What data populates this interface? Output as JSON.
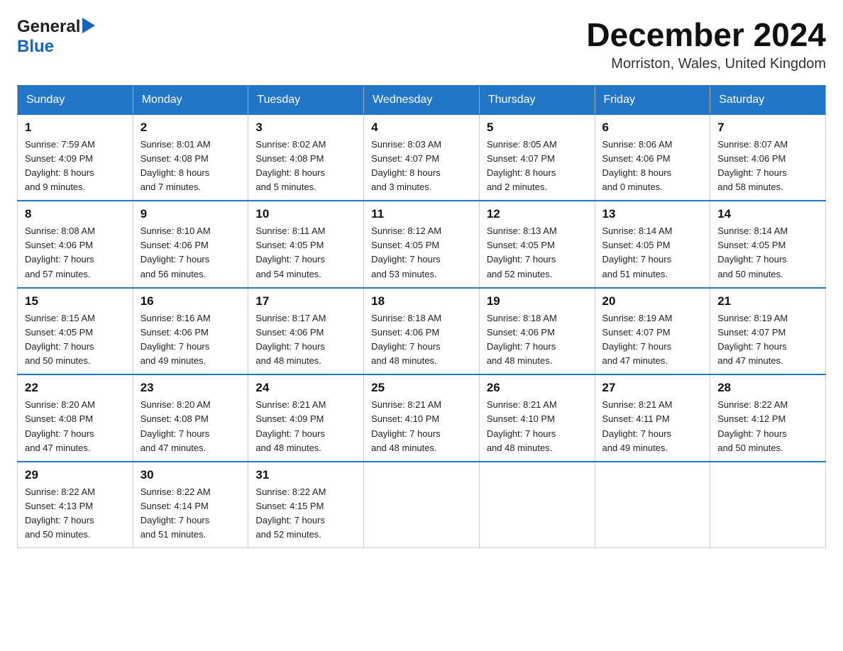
{
  "header": {
    "logo_general": "General",
    "logo_blue": "Blue",
    "month_title": "December 2024",
    "location": "Morriston, Wales, United Kingdom"
  },
  "calendar": {
    "days_of_week": [
      "Sunday",
      "Monday",
      "Tuesday",
      "Wednesday",
      "Thursday",
      "Friday",
      "Saturday"
    ],
    "weeks": [
      [
        {
          "day": "1",
          "info": "Sunrise: 7:59 AM\nSunset: 4:09 PM\nDaylight: 8 hours\nand 9 minutes."
        },
        {
          "day": "2",
          "info": "Sunrise: 8:01 AM\nSunset: 4:08 PM\nDaylight: 8 hours\nand 7 minutes."
        },
        {
          "day": "3",
          "info": "Sunrise: 8:02 AM\nSunset: 4:08 PM\nDaylight: 8 hours\nand 5 minutes."
        },
        {
          "day": "4",
          "info": "Sunrise: 8:03 AM\nSunset: 4:07 PM\nDaylight: 8 hours\nand 3 minutes."
        },
        {
          "day": "5",
          "info": "Sunrise: 8:05 AM\nSunset: 4:07 PM\nDaylight: 8 hours\nand 2 minutes."
        },
        {
          "day": "6",
          "info": "Sunrise: 8:06 AM\nSunset: 4:06 PM\nDaylight: 8 hours\nand 0 minutes."
        },
        {
          "day": "7",
          "info": "Sunrise: 8:07 AM\nSunset: 4:06 PM\nDaylight: 7 hours\nand 58 minutes."
        }
      ],
      [
        {
          "day": "8",
          "info": "Sunrise: 8:08 AM\nSunset: 4:06 PM\nDaylight: 7 hours\nand 57 minutes."
        },
        {
          "day": "9",
          "info": "Sunrise: 8:10 AM\nSunset: 4:06 PM\nDaylight: 7 hours\nand 56 minutes."
        },
        {
          "day": "10",
          "info": "Sunrise: 8:11 AM\nSunset: 4:05 PM\nDaylight: 7 hours\nand 54 minutes."
        },
        {
          "day": "11",
          "info": "Sunrise: 8:12 AM\nSunset: 4:05 PM\nDaylight: 7 hours\nand 53 minutes."
        },
        {
          "day": "12",
          "info": "Sunrise: 8:13 AM\nSunset: 4:05 PM\nDaylight: 7 hours\nand 52 minutes."
        },
        {
          "day": "13",
          "info": "Sunrise: 8:14 AM\nSunset: 4:05 PM\nDaylight: 7 hours\nand 51 minutes."
        },
        {
          "day": "14",
          "info": "Sunrise: 8:14 AM\nSunset: 4:05 PM\nDaylight: 7 hours\nand 50 minutes."
        }
      ],
      [
        {
          "day": "15",
          "info": "Sunrise: 8:15 AM\nSunset: 4:05 PM\nDaylight: 7 hours\nand 50 minutes."
        },
        {
          "day": "16",
          "info": "Sunrise: 8:16 AM\nSunset: 4:06 PM\nDaylight: 7 hours\nand 49 minutes."
        },
        {
          "day": "17",
          "info": "Sunrise: 8:17 AM\nSunset: 4:06 PM\nDaylight: 7 hours\nand 48 minutes."
        },
        {
          "day": "18",
          "info": "Sunrise: 8:18 AM\nSunset: 4:06 PM\nDaylight: 7 hours\nand 48 minutes."
        },
        {
          "day": "19",
          "info": "Sunrise: 8:18 AM\nSunset: 4:06 PM\nDaylight: 7 hours\nand 48 minutes."
        },
        {
          "day": "20",
          "info": "Sunrise: 8:19 AM\nSunset: 4:07 PM\nDaylight: 7 hours\nand 47 minutes."
        },
        {
          "day": "21",
          "info": "Sunrise: 8:19 AM\nSunset: 4:07 PM\nDaylight: 7 hours\nand 47 minutes."
        }
      ],
      [
        {
          "day": "22",
          "info": "Sunrise: 8:20 AM\nSunset: 4:08 PM\nDaylight: 7 hours\nand 47 minutes."
        },
        {
          "day": "23",
          "info": "Sunrise: 8:20 AM\nSunset: 4:08 PM\nDaylight: 7 hours\nand 47 minutes."
        },
        {
          "day": "24",
          "info": "Sunrise: 8:21 AM\nSunset: 4:09 PM\nDaylight: 7 hours\nand 48 minutes."
        },
        {
          "day": "25",
          "info": "Sunrise: 8:21 AM\nSunset: 4:10 PM\nDaylight: 7 hours\nand 48 minutes."
        },
        {
          "day": "26",
          "info": "Sunrise: 8:21 AM\nSunset: 4:10 PM\nDaylight: 7 hours\nand 48 minutes."
        },
        {
          "day": "27",
          "info": "Sunrise: 8:21 AM\nSunset: 4:11 PM\nDaylight: 7 hours\nand 49 minutes."
        },
        {
          "day": "28",
          "info": "Sunrise: 8:22 AM\nSunset: 4:12 PM\nDaylight: 7 hours\nand 50 minutes."
        }
      ],
      [
        {
          "day": "29",
          "info": "Sunrise: 8:22 AM\nSunset: 4:13 PM\nDaylight: 7 hours\nand 50 minutes."
        },
        {
          "day": "30",
          "info": "Sunrise: 8:22 AM\nSunset: 4:14 PM\nDaylight: 7 hours\nand 51 minutes."
        },
        {
          "day": "31",
          "info": "Sunrise: 8:22 AM\nSunset: 4:15 PM\nDaylight: 7 hours\nand 52 minutes."
        },
        {
          "day": "",
          "info": ""
        },
        {
          "day": "",
          "info": ""
        },
        {
          "day": "",
          "info": ""
        },
        {
          "day": "",
          "info": ""
        }
      ]
    ]
  }
}
